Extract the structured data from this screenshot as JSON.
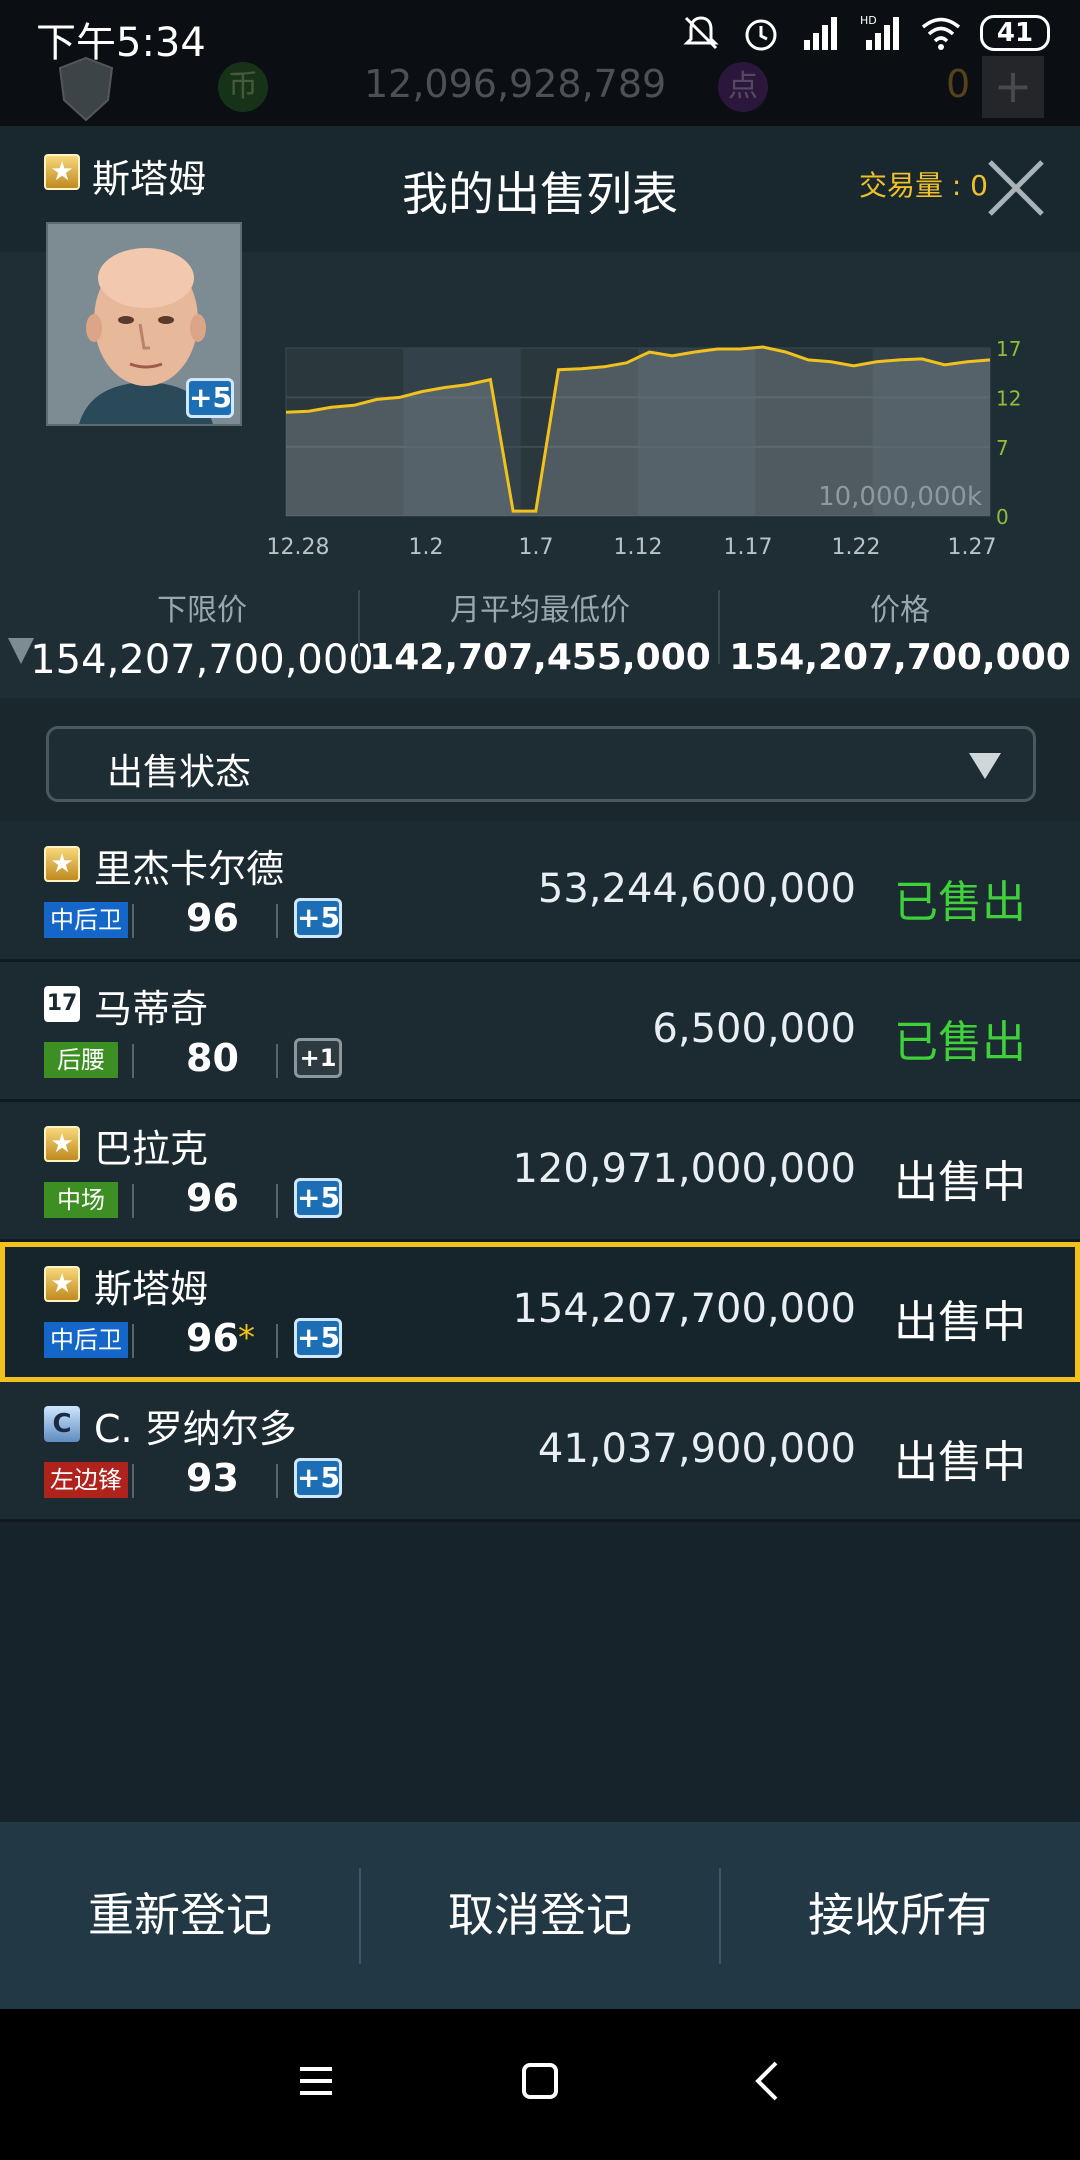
{
  "status_bar": {
    "time": "下午5:34",
    "battery": "41"
  },
  "game_header": {
    "coin_label": "币",
    "coins": "12,096,928,789",
    "point_label": "点",
    "points": "0",
    "plus": "+"
  },
  "dialog": {
    "title": "我的出售列表",
    "player": {
      "grade_icon": "star-badge-icon",
      "name": "斯塔姆",
      "level": "+5",
      "trade_volume": "交易量 : 0"
    },
    "stats": {
      "floor_label": "下限价",
      "floor_value": "154,207,700,000",
      "avg_label": "月平均最低价",
      "avg_value": "142,707,455,000",
      "price_label": "价格",
      "price_value": "154,207,700,000"
    },
    "filter": {
      "label": "出售状态"
    }
  },
  "chart_data": {
    "type": "area",
    "x_ticks": [
      "12.28",
      "1.2",
      "1.7",
      "1.12",
      "1.17",
      "1.22",
      "1.27"
    ],
    "y_ticks": [
      "17",
      "12",
      "7",
      "0"
    ],
    "unit_label": "10,000,000k",
    "ylim": [
      0,
      17
    ],
    "values": [
      10.5,
      10.6,
      11.0,
      11.2,
      11.8,
      12.0,
      12.6,
      13.0,
      13.3,
      13.8,
      0.5,
      0.5,
      14.8,
      14.9,
      15.1,
      15.5,
      16.6,
      16.2,
      16.6,
      16.9,
      16.9,
      17.1,
      16.6,
      15.8,
      15.6,
      15.2,
      15.6,
      15.8,
      15.9,
      15.3,
      15.6,
      15.8
    ],
    "line_color": "#f2c21c",
    "grid": true
  },
  "list": [
    {
      "grade": "star",
      "grade_text": "★",
      "name": "里杰卡尔德",
      "position": "中后卫",
      "pos_color": "#1467c9",
      "ovr": "96",
      "fav": "",
      "level": "+5",
      "level_style": "blue",
      "price": "53,244,600,000",
      "status": "已售出",
      "sold": true
    },
    {
      "grade": "num",
      "grade_text": "17",
      "name": "马蒂奇",
      "position": "后腰",
      "pos_color": "#3e8f23",
      "ovr": "80",
      "fav": "",
      "level": "+1",
      "level_style": "grey",
      "price": "6,500,000",
      "status": "已售出",
      "sold": true
    },
    {
      "grade": "star",
      "grade_text": "★",
      "name": "巴拉克",
      "position": "中场",
      "pos_color": "#3e8f23",
      "ovr": "96",
      "fav": "",
      "level": "+5",
      "level_style": "blue",
      "price": "120,971,000,000",
      "status": "出售中",
      "sold": false
    },
    {
      "grade": "star",
      "grade_text": "★",
      "name": "斯塔姆",
      "position": "中后卫",
      "pos_color": "#1467c9",
      "ovr": "96",
      "fav": "*",
      "level": "+5",
      "level_style": "blue",
      "price": "154,207,700,000",
      "status": "出售中",
      "sold": false,
      "selected": true
    },
    {
      "grade": "c",
      "grade_text": "C",
      "name": "C. 罗纳尔多",
      "position": "左边锋",
      "pos_color": "#b0221c",
      "ovr": "93",
      "fav": "",
      "level": "+5",
      "level_style": "blue",
      "price": "41,037,900,000",
      "status": "出售中",
      "sold": false
    }
  ],
  "footer": {
    "relist": "重新登记",
    "cancel": "取消登记",
    "receive_all": "接收所有"
  }
}
